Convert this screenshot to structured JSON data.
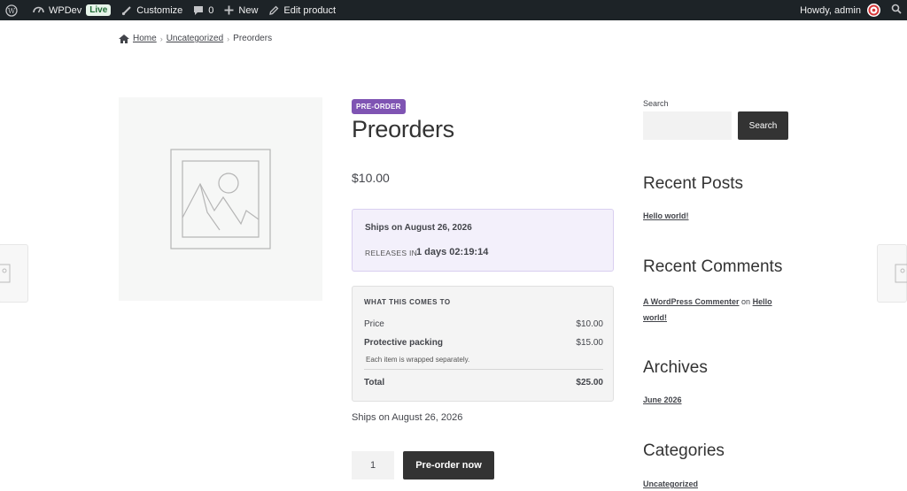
{
  "admin_bar": {
    "site_name": "WPDev",
    "live_badge": "Live",
    "customize": "Customize",
    "comments_count": "0",
    "new": "New",
    "edit_product": "Edit product",
    "howdy": "Howdy, admin"
  },
  "breadcrumb": {
    "home": "Home",
    "category": "Uncategorized",
    "current": "Preorders",
    "separator": "›"
  },
  "product": {
    "badge": "PRE-ORDER",
    "title": "Preorders",
    "price": "$10.00",
    "ships_on": "Ships on August 26, 2026",
    "releases_label": "RELEASES IN",
    "countdown": "1 days 02:19:14",
    "cost_breakdown": {
      "heading": "WHAT THIS COMES TO",
      "rows": [
        {
          "label": "Price",
          "value": "$10.00"
        },
        {
          "label": "Protective packing",
          "value": "$15.00"
        }
      ],
      "note": "Each item is wrapped separately.",
      "total_label": "Total",
      "total_value": "$25.00"
    },
    "ships_line": "Ships on August 26, 2026",
    "quantity": "1",
    "preorder_button": "Pre-order now"
  },
  "sidebar": {
    "search_label": "Search",
    "search_button": "Search",
    "recent_posts_title": "Recent Posts",
    "recent_post": "Hello world!",
    "recent_comments_title": "Recent Comments",
    "comment_author": "A WordPress Commenter",
    "comment_on": "on",
    "comment_post": "Hello world!",
    "archives_title": "Archives",
    "archive_item": "June 2026",
    "categories_title": "Categories",
    "category_item": "Uncategorized"
  },
  "colors": {
    "admin_bar_bg": "#1d2327",
    "badge_purple": "#7f54b3",
    "ship_box_bg": "#f3f0fb",
    "button_dark": "#333333"
  }
}
